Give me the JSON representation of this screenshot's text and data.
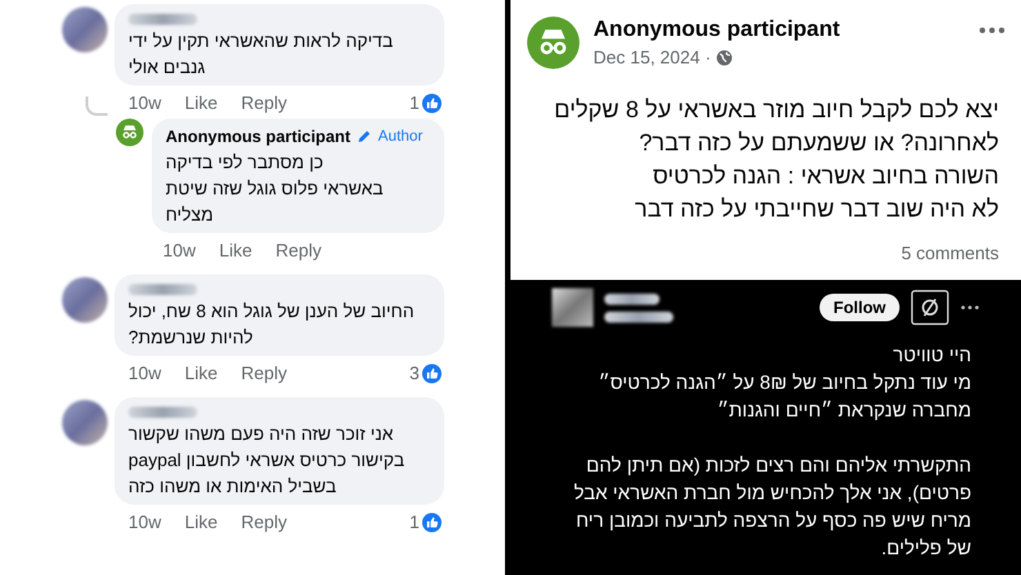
{
  "comments": [
    {
      "text": "בדיקה לראות שהאשראי תקין על ידי\nגנבים אולי",
      "time": "10w",
      "like": "Like",
      "reply": "Reply",
      "reaction_count": "1",
      "children": [
        {
          "author": "Anonymous participant",
          "badge": "Author",
          "text": "כן מסתבר לפי בדיקה\nבאשראי פלוס גוגל שזה שיטת\nמצליח",
          "time": "10w",
          "like": "Like",
          "reply": "Reply"
        }
      ]
    },
    {
      "text": "החיוב של הענן של גוגל הוא 8 שח, יכול\nלהיות שנרשמת?",
      "time": "10w",
      "like": "Like",
      "reply": "Reply",
      "reaction_count": "3"
    },
    {
      "text": "אני זוכר שזה היה פעם משהו שקשור\nבקישור כרטיס אשראי לחשבון paypal\nבשביל האימות או משהו כזה",
      "time": "10w",
      "like": "Like",
      "reply": "Reply",
      "reaction_count": "1"
    }
  ],
  "post": {
    "author": "Anonymous participant",
    "date": "Dec 15, 2024 ·",
    "text": "יצא לכם לקבל חיוב מוזר באשראי על 8 שקלים\nלאחרונה? או ששמעתם על כזה דבר?\nהשורה בחיוב אשראי : הגנה לכרטיס\nלא היה שוב דבר שחייבתי על כזה דבר",
    "comments": "5 comments"
  },
  "thread_post": {
    "follow": "Follow",
    "text": "היי טוויטר\nמי עוד נתקל בחיוב של 8₪ על ״הגנה לכרטיס״\nמחברה שנקראת ״חיים והגנות״\n\nהתקשרתי אליהם והם רצים לזכות (אם תיתן להם\nפרטים), אני אלך להכחיש מול חברת האשראי אבל\nמריח שיש פה כסף על הרצפה לתביעה וכמובן ריח\nשל פלילים."
  }
}
